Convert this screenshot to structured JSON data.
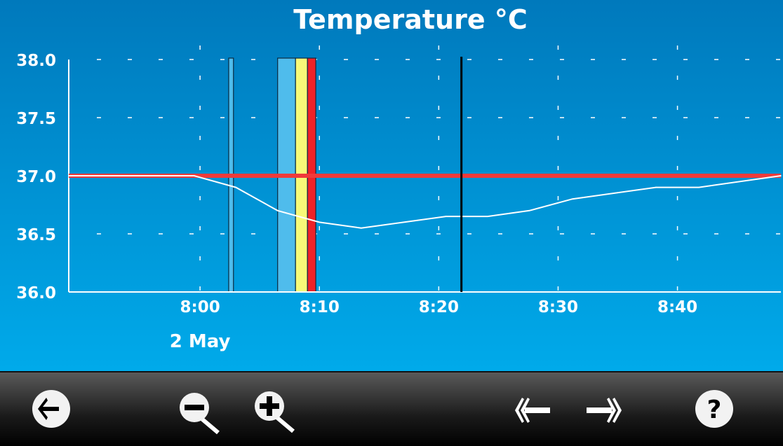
{
  "chart_data": {
    "type": "line",
    "title": "Temperature °C",
    "date_label": "2 May",
    "ylim": [
      36.0,
      38.0
    ],
    "yticks": [
      "38.0",
      "37.5",
      "37.0",
      "36.5",
      "36.0"
    ],
    "xlim": [
      "7:49:00",
      "8:48:40"
    ],
    "xticks": [
      "8:00",
      "8:10",
      "8:20",
      "8:30",
      "8:40"
    ],
    "grid": true,
    "reference_line": {
      "y": 37.0,
      "color": "#f03a3a"
    },
    "series": [
      {
        "color": "#ffffff",
        "x": [
          "7:49:00",
          "7:59:30",
          "8:03:00",
          "8:06:30",
          "8:10:00",
          "8:13:30",
          "8:20:36",
          "8:24:06",
          "8:27:36",
          "8:31:12",
          "8:38:12",
          "8:41:48",
          "8:48:40"
        ],
        "y": [
          37.0,
          37.0,
          36.9,
          36.7,
          36.6,
          36.55,
          36.65,
          36.65,
          36.7,
          36.8,
          36.9,
          36.9,
          37.0
        ]
      }
    ],
    "event_bars": [
      {
        "start": "8:02:24",
        "end": "8:02:48",
        "color": "#4fbcec"
      },
      {
        "start": "8:06:30",
        "end": "8:08:00",
        "color": "#4fbcec"
      },
      {
        "start": "8:08:00",
        "end": "8:09:00",
        "color": "#f8fa78"
      },
      {
        "start": "8:09:00",
        "end": "8:09:42",
        "color": "#ee2228"
      }
    ],
    "cursor_line": {
      "x": "8:21:54",
      "color": "#000000"
    }
  },
  "toolbar": {
    "buttons": [
      {
        "name": "back",
        "icon": "arrow-left-icon"
      },
      {
        "name": "zoom-out",
        "icon": "zoom-out-icon"
      },
      {
        "name": "zoom-in",
        "icon": "zoom-in-icon"
      },
      {
        "name": "scroll-back",
        "icon": "double-chevron-left-icon"
      },
      {
        "name": "scroll-forward",
        "icon": "double-chevron-right-icon"
      },
      {
        "name": "help",
        "icon": "help-icon"
      }
    ]
  }
}
